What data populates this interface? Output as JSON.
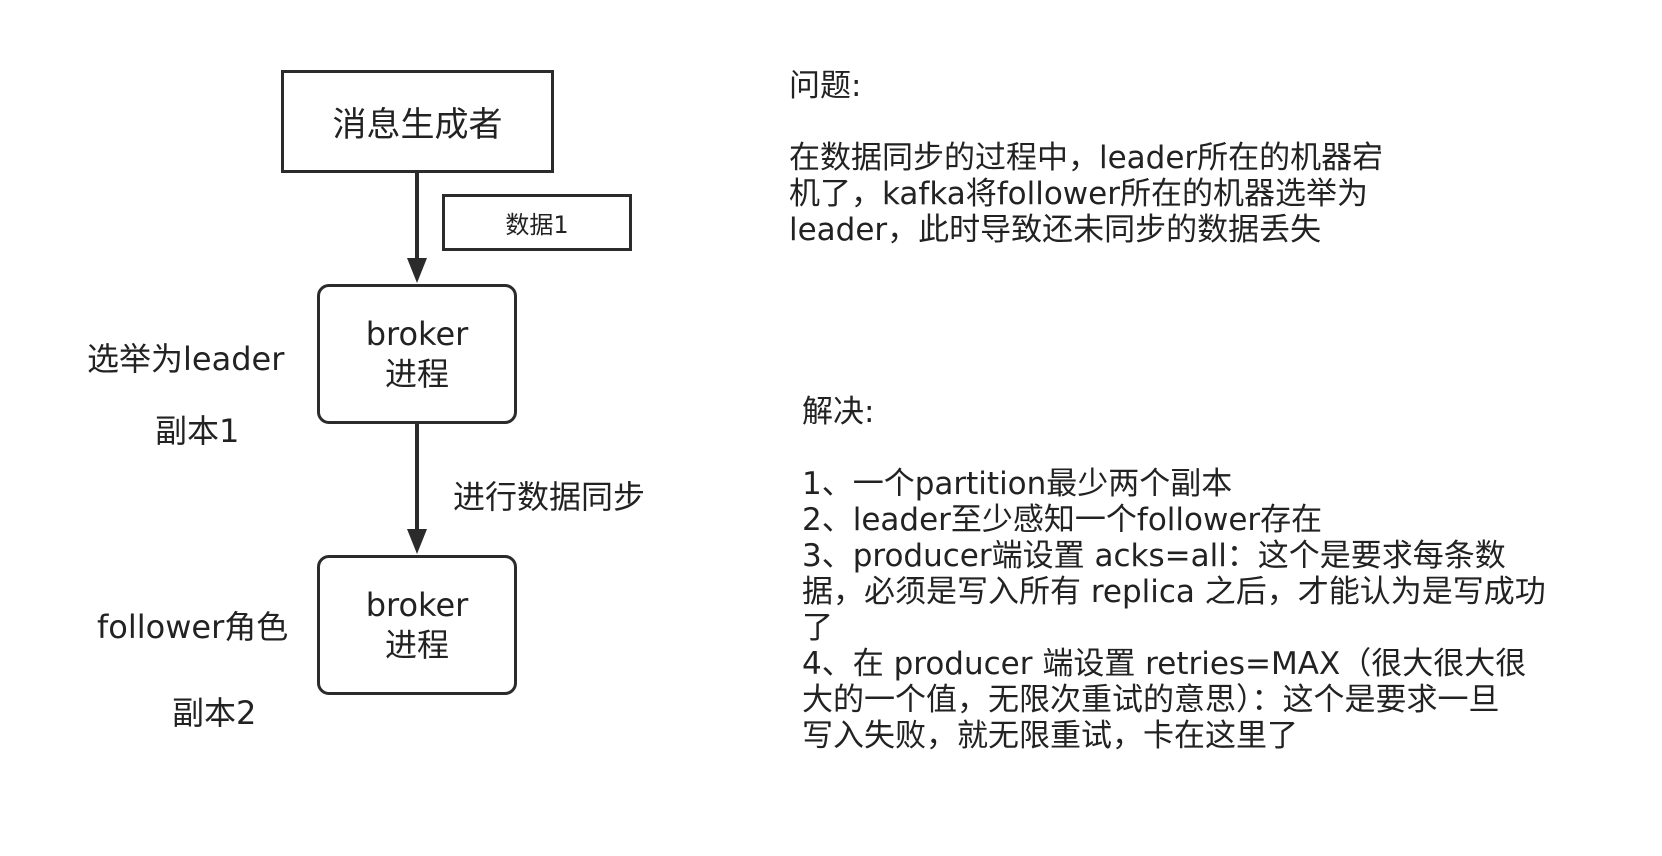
{
  "diagram": {
    "producer": {
      "label": "消息生成者"
    },
    "data_tag": {
      "label": "数据1"
    },
    "broker1": {
      "line1": "broker",
      "line2": "进程"
    },
    "broker2": {
      "line1": "broker",
      "line2": "进程"
    },
    "leader_label": "选举为leader",
    "replica1_label": "副本1",
    "sync_label": "进行数据同步",
    "follower_label": "follower角色",
    "replica2_label": "副本2"
  },
  "problem": {
    "heading": "问题:",
    "lines": [
      "在数据同步的过程中，leader所在的机器宕",
      "机了，kafka将follower所在的机器选举为",
      "leader，此时导致还未同步的数据丢失"
    ]
  },
  "solution": {
    "heading": "解决:",
    "lines": [
      "1、一个partition最少两个副本",
      "2、leader至少感知一个follower存在",
      "3、producer端设置 acks=all：这个是要求每条数",
      "据，必须是写入所有 replica 之后，才能认为是写成功",
      "了",
      "4、在 producer 端设置 retries=MAX（很大很大很",
      "大的一个值，无限次重试的意思）：这个是要求一旦",
      "写入失败，就无限重试，卡在这里了"
    ]
  },
  "colors": {
    "stroke": "#2b2b2b",
    "text": "#222222",
    "background": "#ffffff"
  }
}
